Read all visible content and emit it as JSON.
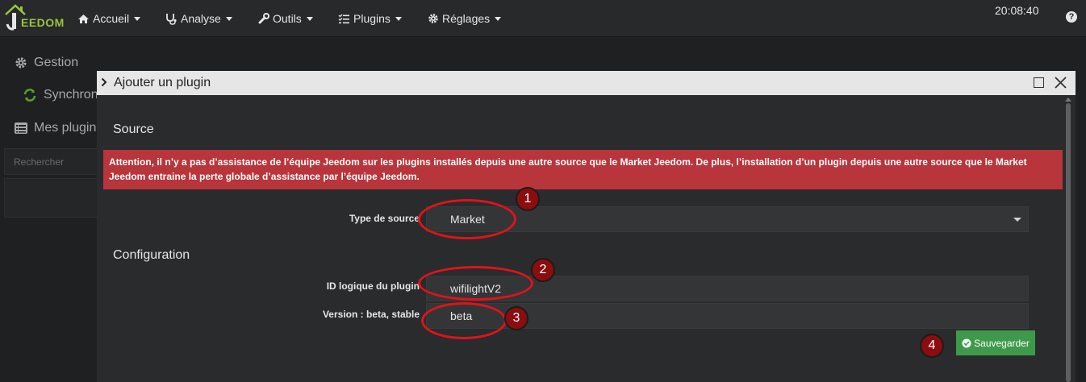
{
  "navbar": {
    "logo_text": "EEDOM",
    "items": [
      {
        "label": "Accueil",
        "icon": "home-icon"
      },
      {
        "label": "Analyse",
        "icon": "stethoscope-icon"
      },
      {
        "label": "Outils",
        "icon": "wrench-icon"
      },
      {
        "label": "Plugins",
        "icon": "tasks-icon"
      },
      {
        "label": "Réglages",
        "icon": "gear-icon"
      }
    ],
    "clock": "20:08:40",
    "help": "?"
  },
  "background": {
    "gestion": "Gestion",
    "synchro": "Synchron",
    "mes_plugins": "Mes plugin",
    "search_placeholder": "Rechercher"
  },
  "modal": {
    "title": "Ajouter un plugin",
    "source_title": "Source",
    "alert": "Attention, il n’y a pas d’assistance de l’équipe Jeedom sur les plugins installés depuis une autre source que le Market Jeedom. De plus, l’installation d’un plugin depuis une autre source que le Market Jeedom entraine la perte globale d’assistance par l’équipe Jeedom.",
    "source_type_label": "Type de source",
    "source_type_value": "Market",
    "config_title": "Configuration",
    "plugin_id_label": "ID logique du plugin",
    "plugin_id_value": "wifilightV2",
    "version_label": "Version : beta, stable",
    "version_value": "beta",
    "save_label": "Sauvegarder"
  },
  "annotations": [
    "1",
    "2",
    "3",
    "4"
  ],
  "colors": {
    "accent_green": "#3e9a4a",
    "alert_red": "#b8353b",
    "annotation_red": "#e0131a",
    "logo_green": "#9bc53d"
  }
}
